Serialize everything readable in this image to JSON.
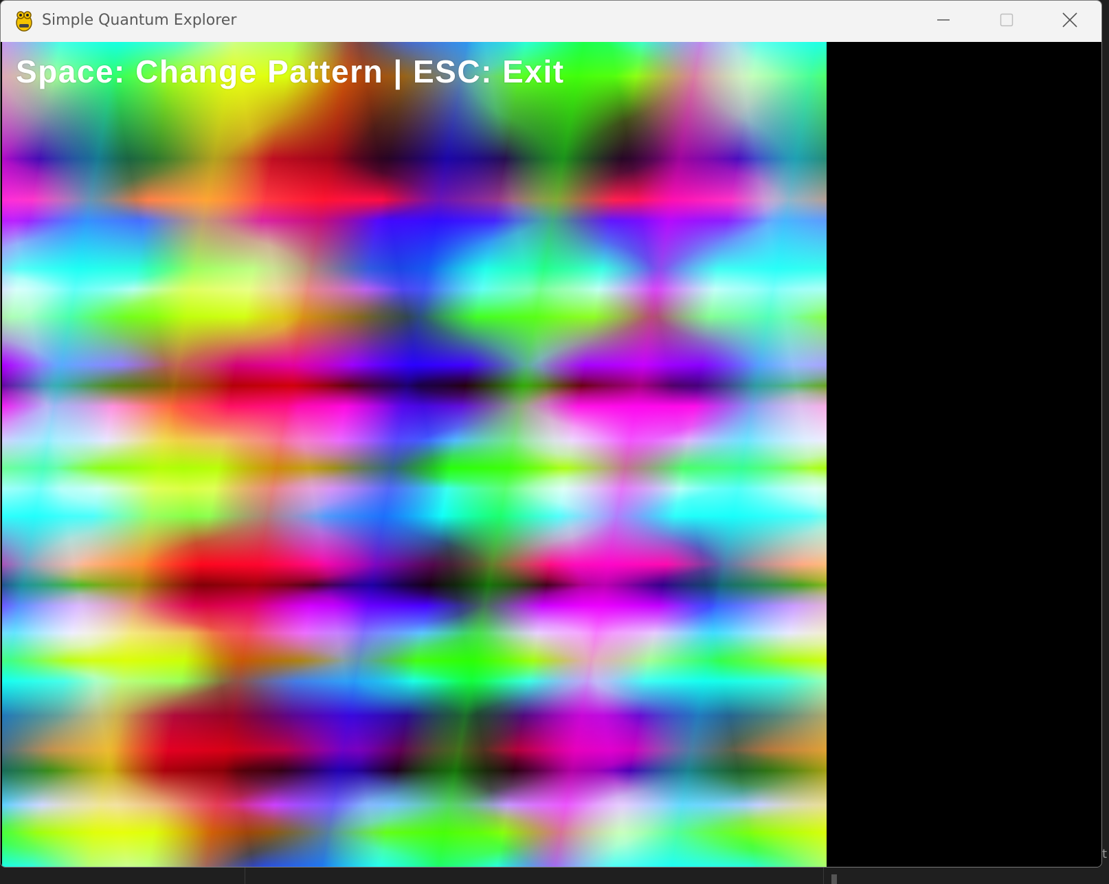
{
  "window": {
    "title": "Simple Quantum Explorer",
    "icon": "pygame-snake-icon",
    "controls": {
      "minimize_icon": "minimize-icon",
      "maximize_icon": "maximize-icon",
      "close_icon": "close-icon"
    }
  },
  "canvas": {
    "hint": "Space: Change Pattern | ESC: Exit"
  },
  "desktop": {
    "edge_text": "t"
  },
  "colors": {
    "titlebar_bg": "#f3f3f3",
    "title_text": "#5a5a5a",
    "hint_text": "#ffffff",
    "side_panel": "#000000"
  }
}
